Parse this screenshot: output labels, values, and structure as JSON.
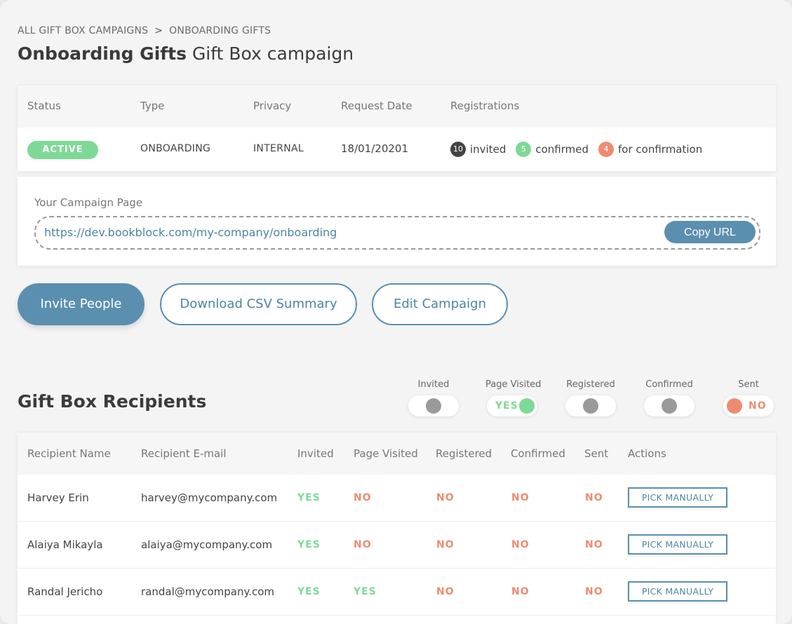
{
  "breadcrumb": {
    "items": [
      "ALL GIFT BOX CAMPAIGNS",
      "ONBOARDING GIFTS"
    ],
    "separator": ">"
  },
  "title": {
    "bold": "Onboarding Gifts",
    "rest": "Gift Box campaign"
  },
  "info": {
    "headers": {
      "status": "Status",
      "type": "Type",
      "privacy": "Privacy",
      "request_date": "Request Date",
      "registrations": "Registrations"
    },
    "status": "ACTIVE",
    "type": "ONBOARDING",
    "privacy": "INTERNAL",
    "request_date": "18/01/20201",
    "registrations": {
      "invited": {
        "count": "10",
        "label": "invited",
        "color": "#444444"
      },
      "confirmed": {
        "count": "5",
        "label": "confirmed",
        "color": "#7ed996"
      },
      "for_confirmation": {
        "count": "4",
        "label": "for confirmation",
        "color": "#ef8b6f"
      }
    }
  },
  "campaign_page": {
    "label": "Your Campaign Page",
    "url": "https://dev.bookblock.com/my-company/onboarding",
    "copy_label": "Copy URL"
  },
  "actions": {
    "invite": "Invite People",
    "download": "Download CSV Summary",
    "edit": "Edit Campaign"
  },
  "recipients": {
    "title": "Gift Box Recipients",
    "filters": [
      {
        "label": "Invited",
        "state": "off",
        "text": ""
      },
      {
        "label": "Page Visited",
        "state": "yes",
        "text": "YES"
      },
      {
        "label": "Registered",
        "state": "off",
        "text": ""
      },
      {
        "label": "Confirmed",
        "state": "off",
        "text": ""
      },
      {
        "label": "Sent",
        "state": "no",
        "text": "NO"
      }
    ],
    "columns": {
      "name": "Recipient Name",
      "email": "Recipient E-mail",
      "invited": "Invited",
      "visited": "Page Visited",
      "registered": "Registered",
      "confirmed": "Confirmed",
      "sent": "Sent",
      "actions": "Actions"
    },
    "rows": [
      {
        "name": "Harvey Erin",
        "email": "harvey@mycompany.com",
        "invited": "YES",
        "visited": "NO",
        "registered": "NO",
        "confirmed": "NO",
        "sent": "NO",
        "action": "PICK MANUALLY"
      },
      {
        "name": "Alaiya Mikayla",
        "email": "alaiya@mycompany.com",
        "invited": "YES",
        "visited": "NO",
        "registered": "NO",
        "confirmed": "NO",
        "sent": "NO",
        "action": "PICK MANUALLY"
      },
      {
        "name": "Randal Jericho",
        "email": "randal@mycompany.com",
        "invited": "YES",
        "visited": "YES",
        "registered": "NO",
        "confirmed": "NO",
        "sent": "NO",
        "action": "PICK MANUALLY"
      }
    ]
  },
  "colors": {
    "accent": "#5b8faf",
    "yes": "#7ed996",
    "no": "#ef8b6f",
    "off": "#9a9a9a"
  }
}
